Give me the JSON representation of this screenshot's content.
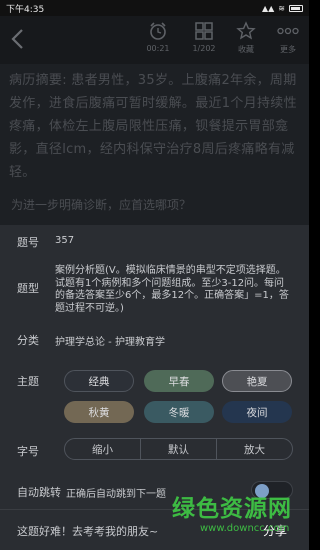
{
  "status_bar": {
    "time": "下午4:35",
    "signal": "▲▲",
    "wifi": "≋"
  },
  "toolbar": {
    "timer_label": "00:21",
    "progress_label": "1/202",
    "favorite_label": "收藏",
    "more_label": "更多"
  },
  "content": {
    "summary": "病历摘要: 患者男性，35岁。上腹痛2年余，周期发作，进食后腹痛可暂时缓解。最近1个月持续性疼痛，体检左上腹局限性压痛，钡餐提示胃部龛影，直径lcm，经内科保守治疗8周后疼痛略有减轻。",
    "question": "为进一步明确诊断，应首选哪项？"
  },
  "sheet": {
    "id_label": "题号",
    "id_value": "357",
    "type_label": "题型",
    "type_value": "案例分析题(V。模拟临床情景的串型不定项选择题。试题有1个病例和多个问题组成。至少3-12问。每问的备选答案至少6个，最多12个。正确答案」=1，答题过程不可逆。)",
    "category_label": "分类",
    "category_value": "护理学总论 - 护理教育学",
    "theme_label": "主题",
    "themes": [
      "经典",
      "早春",
      "艳夏",
      "秋黄",
      "冬暖",
      "夜间"
    ],
    "font_label": "字号",
    "font_sizes": [
      "缩小",
      "默认",
      "放大"
    ],
    "autojump_label": "自动跳转",
    "autojump_desc": "正确后自动跳到下一题",
    "autojump_enabled": true,
    "share_text": "这题好难！去考考我的朋友~",
    "share_button": "分享"
  },
  "watermark": {
    "title": "绿色资源网",
    "url": "www.downcc.com"
  },
  "colors": {
    "accent": "#7d9fc7",
    "watermark": "#3fc845"
  }
}
